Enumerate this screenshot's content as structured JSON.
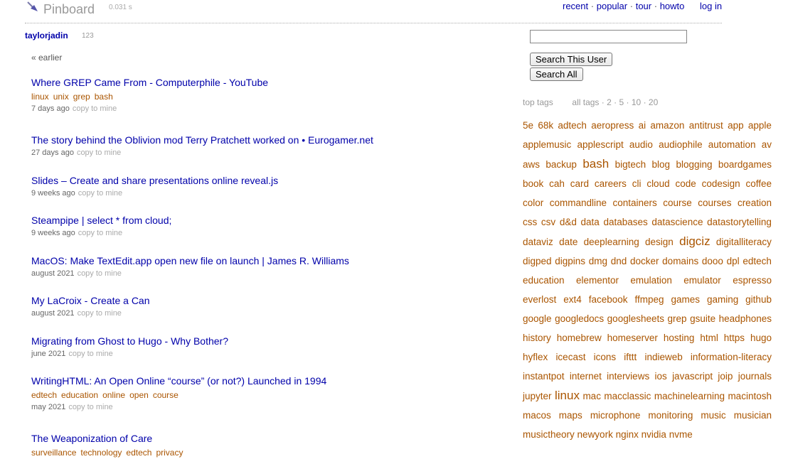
{
  "header": {
    "logo_text": "Pinboard",
    "timing": "0.031 s",
    "nav": [
      "recent",
      "popular",
      "tour",
      "howto"
    ],
    "login": "log in"
  },
  "user": {
    "name": "taylorjadin",
    "count": "123",
    "earlier": "« earlier"
  },
  "bookmarks": [
    {
      "title": "Where GREP Came From - Computerphile - YouTube",
      "tags": [
        "linux",
        "unix",
        "grep",
        "bash"
      ],
      "when": "7 days ago",
      "copy": "copy to mine"
    },
    {
      "title": "The story behind the Oblivion mod Terry Pratchett worked on • Eurogamer.net",
      "tags": [],
      "when": "27 days ago",
      "copy": "copy to mine"
    },
    {
      "title": "Slides – Create and share presentations online reveal.js",
      "tags": [],
      "when": "9 weeks ago",
      "copy": "copy to mine"
    },
    {
      "title": "Steampipe | select * from cloud;",
      "tags": [],
      "when": "9 weeks ago",
      "copy": "copy to mine"
    },
    {
      "title": "MacOS: Make TextEdit.app open new file on launch | James R. Williams",
      "tags": [],
      "when": "august 2021",
      "copy": "copy to mine"
    },
    {
      "title": "My LaCroix - Create a Can",
      "tags": [],
      "when": "august 2021",
      "copy": "copy to mine"
    },
    {
      "title": "Migrating from Ghost to Hugo - Why Bother?",
      "tags": [],
      "when": "june 2021",
      "copy": "copy to mine"
    },
    {
      "title": "WritingHTML: An Open Online “course” (or not?) Launched in 1994",
      "tags": [
        "edtech",
        "education",
        "online",
        "open",
        "course"
      ],
      "when": "may 2021",
      "copy": "copy to mine"
    },
    {
      "title": "The Weaponization of Care",
      "tags": [
        "surveillance",
        "technology",
        "edtech",
        "privacy"
      ],
      "when": "",
      "copy": ""
    }
  ],
  "search": {
    "placeholder": "",
    "btn_user": "Search This User",
    "btn_all": "Search All"
  },
  "tags_header": {
    "top": "top tags",
    "all": "all tags",
    "counts": [
      "2",
      "5",
      "10",
      "20"
    ]
  },
  "tag_cloud": [
    {
      "t": "5e"
    },
    {
      "t": "68k"
    },
    {
      "t": "adtech"
    },
    {
      "t": "aeropress"
    },
    {
      "t": "ai"
    },
    {
      "t": "amazon"
    },
    {
      "t": "antitrust"
    },
    {
      "t": "app"
    },
    {
      "t": "apple"
    },
    {
      "t": "applemusic"
    },
    {
      "t": "applescript"
    },
    {
      "t": "audio"
    },
    {
      "t": "audiophile"
    },
    {
      "t": "automation"
    },
    {
      "t": "av"
    },
    {
      "t": "aws"
    },
    {
      "t": "backup"
    },
    {
      "t": "bash",
      "big": true
    },
    {
      "t": "bigtech"
    },
    {
      "t": "blog"
    },
    {
      "t": "blogging"
    },
    {
      "t": "boardgames"
    },
    {
      "t": "book"
    },
    {
      "t": "cah"
    },
    {
      "t": "card"
    },
    {
      "t": "careers"
    },
    {
      "t": "cli"
    },
    {
      "t": "cloud"
    },
    {
      "t": "code"
    },
    {
      "t": "codesign"
    },
    {
      "t": "coffee"
    },
    {
      "t": "color"
    },
    {
      "t": "commandline"
    },
    {
      "t": "containers"
    },
    {
      "t": "course"
    },
    {
      "t": "courses"
    },
    {
      "t": "creation"
    },
    {
      "t": "css"
    },
    {
      "t": "csv"
    },
    {
      "t": "d&d"
    },
    {
      "t": "data"
    },
    {
      "t": "databases"
    },
    {
      "t": "datascience"
    },
    {
      "t": "datastorytelling"
    },
    {
      "t": "dataviz"
    },
    {
      "t": "date"
    },
    {
      "t": "deeplearning"
    },
    {
      "t": "design"
    },
    {
      "t": "digciz",
      "big": true
    },
    {
      "t": "digitalliteracy"
    },
    {
      "t": "digped"
    },
    {
      "t": "digpins"
    },
    {
      "t": "dmg"
    },
    {
      "t": "dnd"
    },
    {
      "t": "docker"
    },
    {
      "t": "domains"
    },
    {
      "t": "dooo"
    },
    {
      "t": "dpl"
    },
    {
      "t": "edtech"
    },
    {
      "t": "education"
    },
    {
      "t": "elementor"
    },
    {
      "t": "emulation"
    },
    {
      "t": "emulator"
    },
    {
      "t": "espresso"
    },
    {
      "t": "everlost"
    },
    {
      "t": "ext4"
    },
    {
      "t": "facebook"
    },
    {
      "t": "ffmpeg"
    },
    {
      "t": "games"
    },
    {
      "t": "gaming"
    },
    {
      "t": "github"
    },
    {
      "t": "google"
    },
    {
      "t": "googledocs"
    },
    {
      "t": "googlesheets"
    },
    {
      "t": "grep"
    },
    {
      "t": "gsuite"
    },
    {
      "t": "headphones"
    },
    {
      "t": "history"
    },
    {
      "t": "homebrew"
    },
    {
      "t": "homeserver"
    },
    {
      "t": "hosting"
    },
    {
      "t": "html"
    },
    {
      "t": "https"
    },
    {
      "t": "hugo"
    },
    {
      "t": "hyflex"
    },
    {
      "t": "icecast"
    },
    {
      "t": "icons"
    },
    {
      "t": "ifttt"
    },
    {
      "t": "indieweb"
    },
    {
      "t": "information-literacy"
    },
    {
      "t": "instantpot"
    },
    {
      "t": "internet"
    },
    {
      "t": "interviews"
    },
    {
      "t": "ios"
    },
    {
      "t": "javascript"
    },
    {
      "t": "joip"
    },
    {
      "t": "journals"
    },
    {
      "t": "jupyter"
    },
    {
      "t": "linux",
      "big": true
    },
    {
      "t": "mac"
    },
    {
      "t": "macclassic"
    },
    {
      "t": "machinelearning"
    },
    {
      "t": "macintosh"
    },
    {
      "t": "macos"
    },
    {
      "t": "maps"
    },
    {
      "t": "microphone"
    },
    {
      "t": "monitoring"
    },
    {
      "t": "music"
    },
    {
      "t": "musician"
    },
    {
      "t": "musictheory"
    },
    {
      "t": "newyork"
    },
    {
      "t": "nginx"
    },
    {
      "t": "nvidia"
    },
    {
      "t": "nvme"
    }
  ]
}
